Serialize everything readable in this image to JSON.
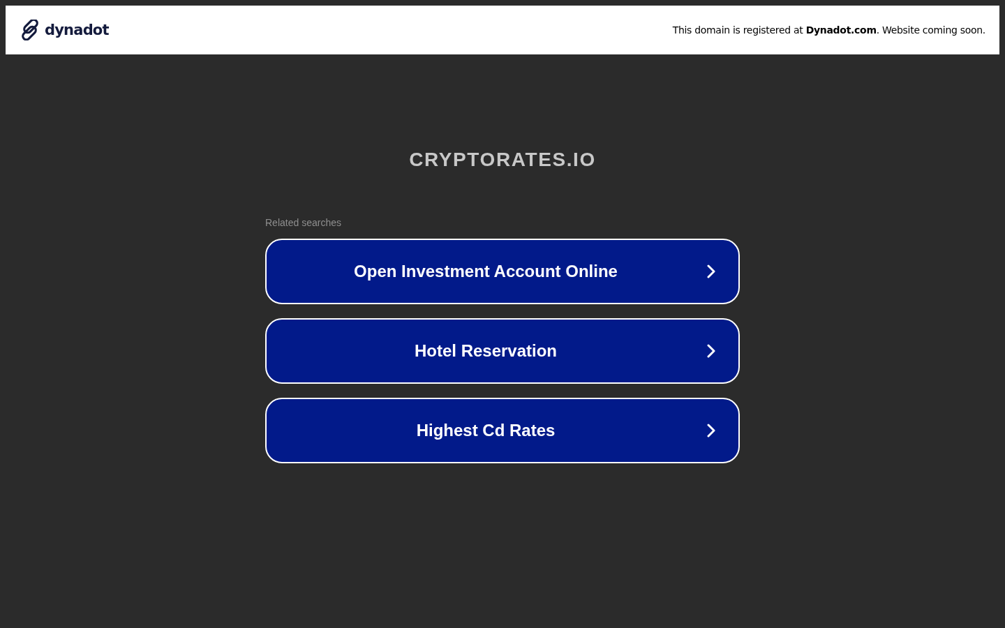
{
  "header": {
    "logo": {
      "text": "dynadot"
    },
    "notice": "This domain is registered at **Dynadot.com**. Website coming soon."
  },
  "domain_title": "CRYPTORATES.IO",
  "related": {
    "label": "Related searches",
    "links": [
      "Open Investment Account Online",
      "Hotel Reservation",
      "Highest Cd Rates"
    ]
  }
}
